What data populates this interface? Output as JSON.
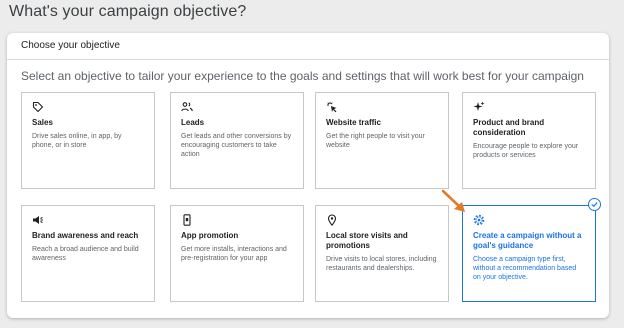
{
  "page": {
    "title": "What's your campaign objective?"
  },
  "panel": {
    "header": "Choose your objective",
    "subtitle": "Select an objective to tailor your experience to the goals and settings that will work best for your campaign"
  },
  "cards": [
    {
      "icon": "tag-icon",
      "title": "Sales",
      "description": "Drive sales online, in app, by phone, or in store"
    },
    {
      "icon": "people-icon",
      "title": "Leads",
      "description": "Get leads and other conversions by encouraging customers to take action"
    },
    {
      "icon": "cursor-click-icon",
      "title": "Website traffic",
      "description": "Get the right people to visit your website"
    },
    {
      "icon": "sparkle-icon",
      "title": "Product and brand consideration",
      "description": "Encourage people to explore your products or services"
    },
    {
      "icon": "megaphone-icon",
      "title": "Brand awareness and reach",
      "description": "Reach a broad audience and build awareness"
    },
    {
      "icon": "phone-icon",
      "title": "App promotion",
      "description": "Get more installs, interactions and pre-registration for your app"
    },
    {
      "icon": "location-pin-icon",
      "title": "Local store visits and promotions",
      "description": "Drive visits to local stores, including restaurants and dealerships."
    },
    {
      "icon": "gear-icon",
      "title": "Create a campaign without a goal's guidance",
      "description": "Choose a campaign type first, without a recommendation based on your objective.",
      "selected": true
    }
  ],
  "colors": {
    "accent": "#1a73e8",
    "annotation_arrow": "#e07b2a"
  }
}
